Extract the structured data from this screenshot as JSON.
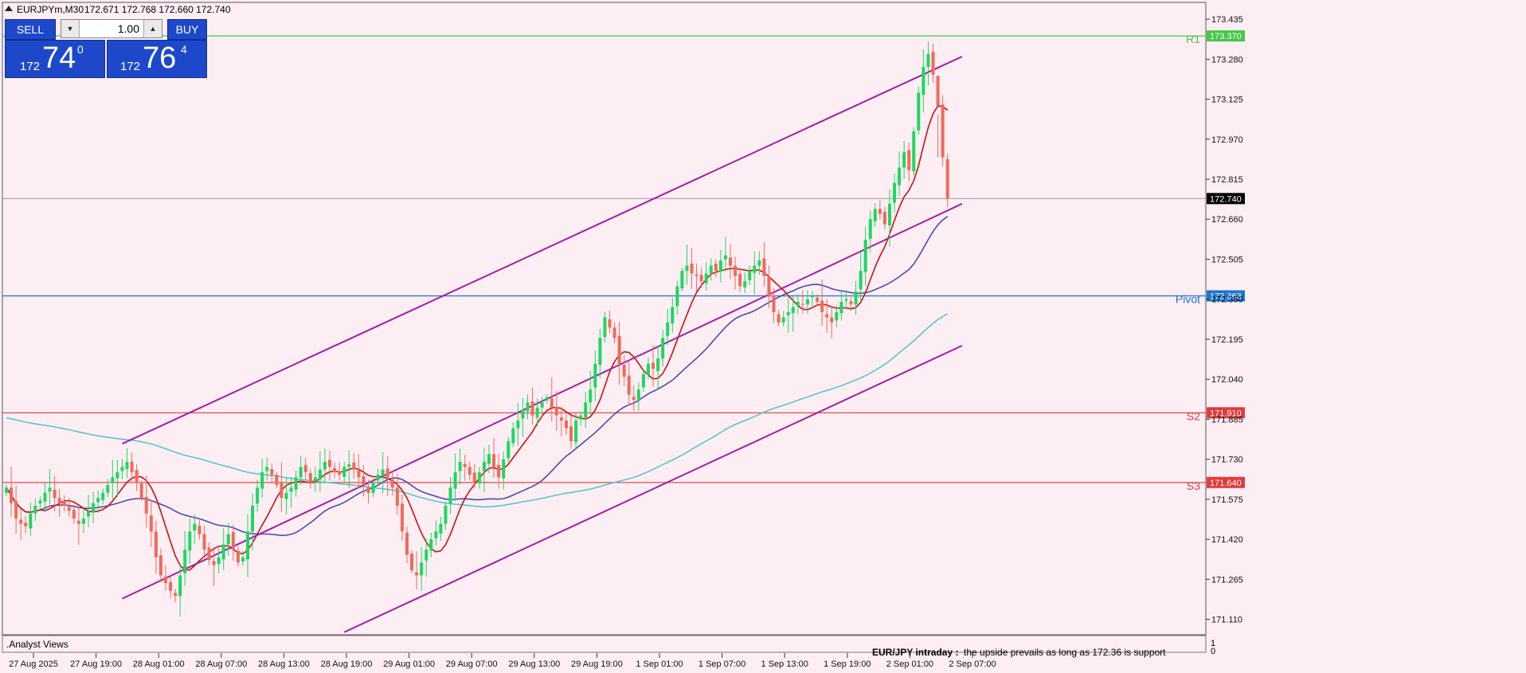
{
  "header": {
    "symbol_label": "EURJPYm,M30",
    "ohlc": "172.671 172.768 172.660 172.740"
  },
  "trade_panel": {
    "sell_label": "SELL",
    "buy_label": "BUY",
    "lot_value": "1.00",
    "sell_price": {
      "small": "172",
      "big": "74",
      "sup": "0"
    },
    "buy_price": {
      "small": "172",
      "big": "76",
      "sup": "4"
    }
  },
  "indicator_window": {
    "label": ".Analyst Views",
    "comment_bold": "EUR/JPY intraday :",
    "comment_text": "the upside prevails as long as 172.36 is support",
    "scale_top": "1",
    "scale_bottom": "0"
  },
  "colors": {
    "background": "#fdeef4",
    "up_candle": "#1ed760",
    "down_candle": "#f06a5a",
    "channel": "#a020a0",
    "ma_fast": "#cc1111",
    "ma_mid": "#4e4aa8",
    "ma_slow": "#58c6c6",
    "pivot": "#1976d2",
    "support_resistance": "#e23a3a",
    "r1": "#46c846"
  },
  "chart_data": {
    "type": "candlestick",
    "symbol": "EURJPYm",
    "timeframe": "M30",
    "ylim": [
      171.05,
      173.5
    ],
    "y_ticks": [
      "173.435",
      "173.280",
      "173.125",
      "172.970",
      "172.815",
      "172.660",
      "172.505",
      "172.350",
      "172.195",
      "172.040",
      "171.885",
      "171.730",
      "171.575",
      "171.420",
      "171.265",
      "171.110"
    ],
    "x_ticks": [
      "27 Aug 2025",
      "27 Aug 19:00",
      "28 Aug 01:00",
      "28 Aug 07:00",
      "28 Aug 13:00",
      "28 Aug 19:00",
      "29 Aug 01:00",
      "29 Aug 07:00",
      "29 Aug 13:00",
      "29 Aug 19:00",
      "1 Sep 01:00",
      "1 Sep 07:00",
      "1 Sep 13:00",
      "1 Sep 19:00",
      "2 Sep 01:00",
      "2 Sep 07:00"
    ],
    "current_price": {
      "value": 172.74,
      "label": "172.740"
    },
    "levels": [
      {
        "name": "R1",
        "value": 173.37,
        "label": "173.370",
        "color": "#46c846"
      },
      {
        "name": "Pivot",
        "value": 172.363,
        "label": "172.363",
        "color": "#1976d2"
      },
      {
        "name": "S2",
        "value": 171.91,
        "label": "171.910",
        "color": "#e23a3a"
      },
      {
        "name": "S3",
        "value": 171.64,
        "label": "171.640",
        "color": "#e23a3a"
      }
    ],
    "channel": {
      "upper": [
        [
          24,
          171.79
        ],
        [
          198,
          173.29
        ]
      ],
      "middle": [
        [
          24,
          171.19
        ],
        [
          198,
          172.72
        ]
      ],
      "lower": [
        [
          70,
          171.06
        ],
        [
          198,
          172.17
        ]
      ]
    },
    "closes": [
      171.62,
      171.56,
      171.5,
      171.48,
      171.47,
      171.52,
      171.55,
      171.57,
      171.6,
      171.62,
      171.58,
      171.56,
      171.55,
      171.53,
      171.5,
      171.48,
      171.5,
      171.53,
      171.56,
      171.58,
      171.6,
      171.63,
      171.66,
      171.68,
      171.7,
      171.72,
      171.68,
      171.64,
      171.58,
      171.52,
      171.45,
      171.35,
      171.28,
      171.25,
      171.22,
      171.2,
      171.28,
      171.38,
      171.45,
      171.48,
      171.44,
      171.38,
      171.34,
      171.32,
      171.35,
      171.4,
      171.44,
      171.38,
      171.33,
      171.35,
      171.45,
      171.55,
      171.62,
      171.68,
      171.7,
      171.67,
      171.63,
      171.58,
      171.6,
      171.62,
      171.66,
      171.7,
      171.68,
      171.64,
      171.66,
      171.69,
      171.72,
      171.7,
      171.68,
      171.67,
      171.7,
      171.71,
      171.69,
      171.66,
      171.63,
      171.6,
      171.64,
      171.67,
      171.69,
      171.66,
      171.62,
      171.55,
      171.45,
      171.36,
      171.3,
      171.28,
      171.33,
      171.38,
      171.42,
      171.45,
      171.48,
      171.55,
      171.62,
      171.68,
      171.72,
      171.7,
      171.67,
      171.64,
      171.68,
      171.72,
      171.75,
      171.7,
      171.66,
      171.73,
      171.8,
      171.85,
      171.88,
      171.92,
      171.95,
      171.9,
      171.93,
      171.95,
      171.97,
      171.93,
      171.9,
      171.88,
      171.85,
      171.8,
      171.88,
      171.9,
      171.95,
      172.0,
      172.1,
      172.2,
      172.28,
      172.24,
      172.2,
      172.1,
      172.05,
      171.98,
      171.96,
      172.0,
      172.06,
      172.1,
      172.08,
      172.12,
      172.2,
      172.26,
      172.32,
      172.4,
      172.46,
      172.48,
      172.45,
      172.44,
      172.42,
      172.45,
      172.48,
      172.46,
      172.5,
      172.52,
      172.48,
      172.44,
      172.4,
      172.42,
      172.46,
      172.48,
      172.5,
      172.44,
      172.36,
      172.3,
      172.26,
      172.28,
      172.3,
      172.32,
      172.34,
      172.33,
      172.35,
      172.36,
      172.34,
      172.3,
      172.28,
      172.26,
      172.3,
      172.34,
      172.35,
      172.33,
      172.38,
      172.46,
      172.58,
      172.66,
      172.7,
      172.68,
      172.64,
      172.72,
      172.8,
      172.86,
      172.92,
      172.85,
      173.0,
      173.15,
      173.25,
      173.3,
      173.22,
      173.1,
      172.9,
      172.74
    ]
  }
}
